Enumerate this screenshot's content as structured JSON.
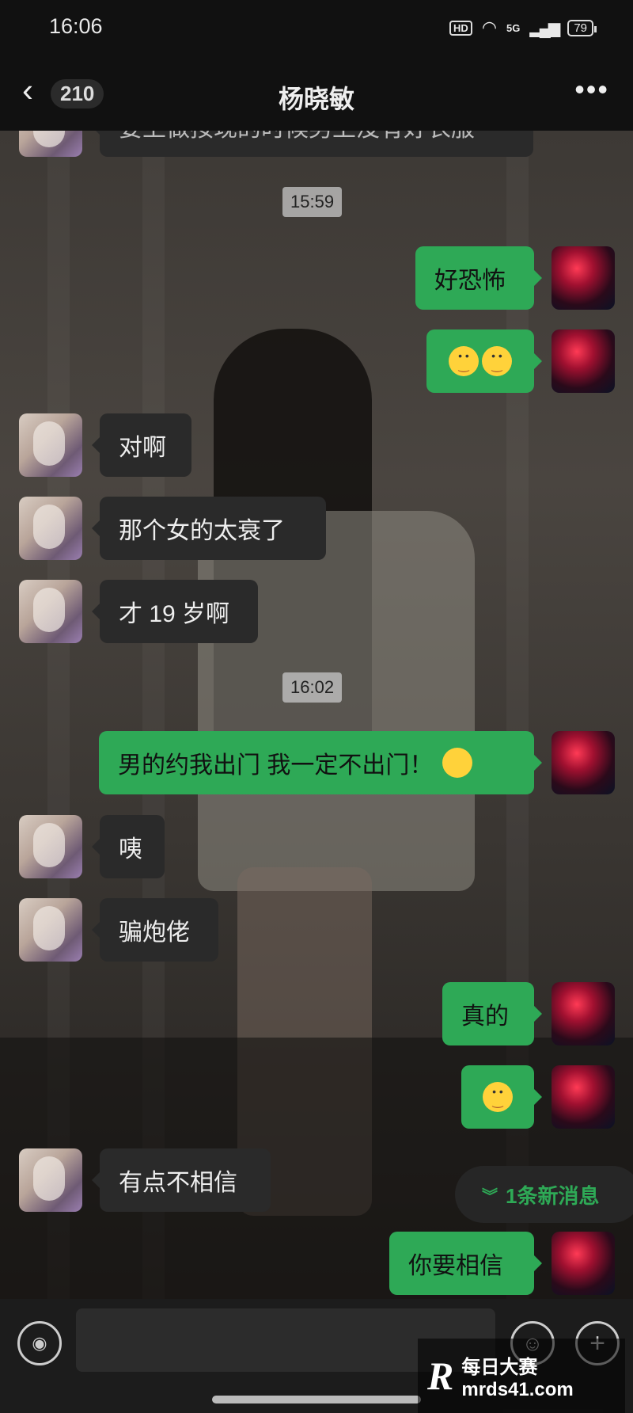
{
  "status_bar": {
    "time": "16:06",
    "hd": "HD",
    "network": "5G",
    "battery": "79"
  },
  "header": {
    "unread_count": "210",
    "contact_name": "杨晓敏"
  },
  "messages": {
    "m0": "要上做按现的时候男上没有好衣服",
    "t1": "15:59",
    "m1": "好恐怖",
    "m3": "对啊",
    "m4": "那个女的太衰了",
    "m5": "才 19 岁啊",
    "t2": "16:02",
    "m6": "男的约我出门  我一定不出门！",
    "m7": "咦",
    "m8": "骗炮佬",
    "m9": "真的",
    "m11": "有点不相信",
    "m12": "你要相信"
  },
  "new_message_pill": "1条新消息",
  "watermark": {
    "logo": "R",
    "brand": "每日大赛",
    "url": "mrds41.com"
  },
  "icons": {
    "back": "chevron-left-icon",
    "more": "more-dots-icon",
    "voice": "voice-icon",
    "emoji": "emoji-icon",
    "add": "plus-icon"
  },
  "colors": {
    "outgoing_bubble": "#2ea956",
    "incoming_bubble": "#2a2a2a",
    "accent": "#2ea956"
  }
}
